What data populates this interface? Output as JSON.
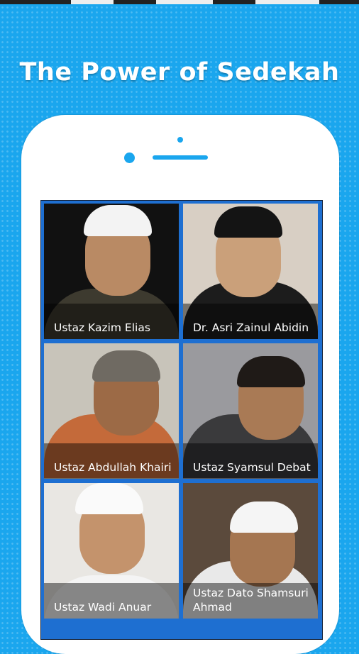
{
  "banner": {
    "title": "The Power of Sedekah"
  },
  "speakers": [
    {
      "name": "Ustaz Kazim Elias"
    },
    {
      "name": "Dr. Asri Zainul Abidin"
    },
    {
      "name": "Ustaz Abdullah Khairi"
    },
    {
      "name": "Ustaz Syamsul Debat"
    },
    {
      "name": "Ustaz Wadi Anuar"
    },
    {
      "name": "Ustaz Dato Shamsuri Ahmad"
    }
  ],
  "colors": {
    "background": "#1aa6ee",
    "phone": "#ffffff",
    "screen": "#1e6fd1"
  }
}
